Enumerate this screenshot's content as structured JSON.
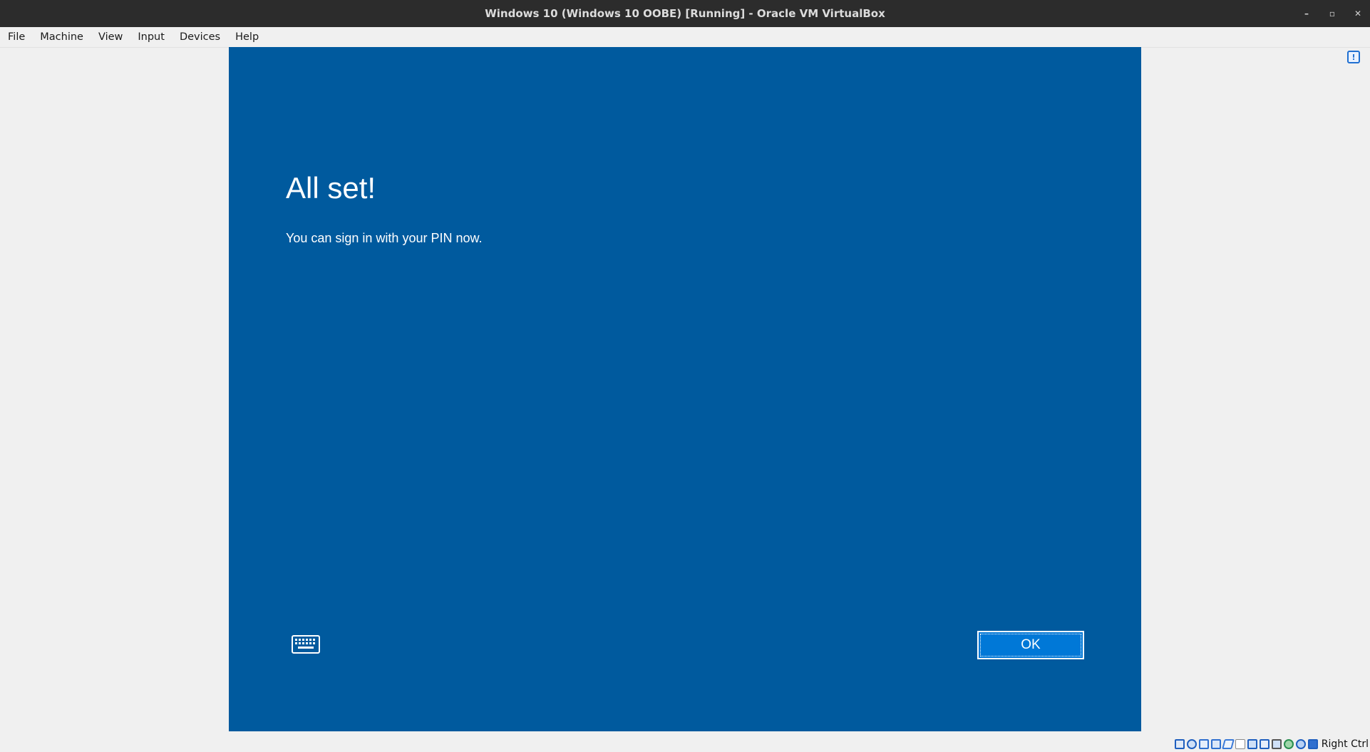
{
  "window": {
    "title": "Windows 10 (Windows 10 OOBE) [Running] - Oracle VM VirtualBox",
    "minimize_glyph": "–",
    "restore_glyph": "▫",
    "close_glyph": "✕"
  },
  "menu": {
    "items": [
      "File",
      "Machine",
      "View",
      "Input",
      "Devices",
      "Help"
    ]
  },
  "guest": {
    "title": "All set!",
    "subtitle": "You can sign in with your PIN now.",
    "ok_label": "OK",
    "background": "#005a9e",
    "button_color": "#0078d7"
  },
  "statusbar": {
    "host_key": "Right Ctrl",
    "icons": [
      "hard-disk-icon",
      "optical-drive-icon",
      "audio-icon",
      "network-icon",
      "usb-icon",
      "shared-folder-icon",
      "display-icon",
      "video-capture-icon",
      "mouse-integration-icon",
      "recording-icon",
      "cpu-icon",
      "keyboard-capture-icon"
    ]
  }
}
